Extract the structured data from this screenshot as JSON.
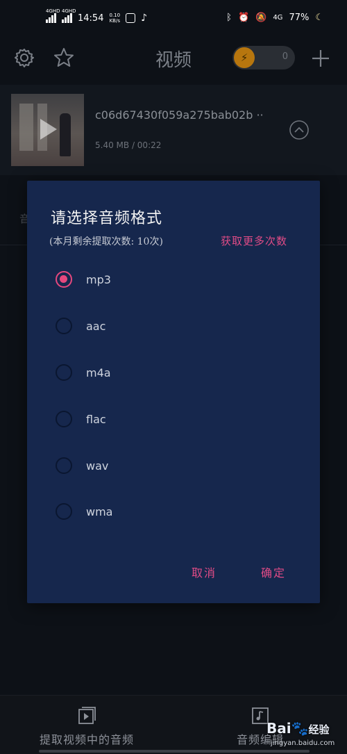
{
  "status_bar": {
    "net1": "4GHD",
    "net2": "4GHD",
    "time": "14:54",
    "speed_value": "0.10",
    "speed_unit": "KB/s",
    "net_right": "4G",
    "battery": "77%"
  },
  "app_bar": {
    "title": "视频",
    "counter": "0"
  },
  "video": {
    "name": "c06d67430f059a275bab02b ··",
    "size": "5.40 MB",
    "separator": " / ",
    "duration": "00:22"
  },
  "background": {
    "partial_tab_text": "音"
  },
  "dialog": {
    "title": "请选择音频格式",
    "subtitle": "(本月剩余提取次数: 10次)",
    "more_link": "获取更多次数",
    "options": [
      {
        "label": "mp3",
        "selected": true
      },
      {
        "label": "aac",
        "selected": false
      },
      {
        "label": "m4a",
        "selected": false
      },
      {
        "label": "flac",
        "selected": false
      },
      {
        "label": "wav",
        "selected": false
      },
      {
        "label": "wma",
        "selected": false
      }
    ],
    "cancel_label": "取消",
    "ok_label": "确定"
  },
  "bottom_nav": {
    "extract_label": "提取视频中的音频",
    "edit_label": "音频编辑"
  },
  "watermark": {
    "brand": "Bai",
    "brand_suffix": "经验",
    "url": "jingyan.baidu.com"
  },
  "colors": {
    "accent": "#e04b86",
    "dialog_bg": "#16274d",
    "page_bg": "#0d1117"
  }
}
